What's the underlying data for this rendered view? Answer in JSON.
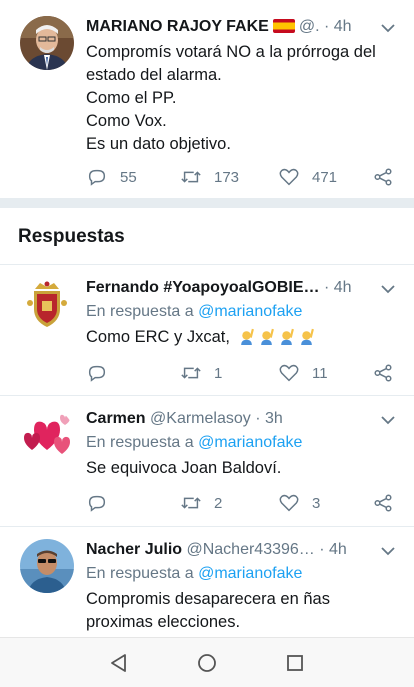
{
  "main_tweet": {
    "author_name": "MARIANO RAJOY FAKE",
    "handle": "@.",
    "time": "4h",
    "lines": [
      "Compromís votará NO a la prórroga del",
      "estado del alarma.",
      "Como el PP.",
      "Como Vox.",
      "Es un dato objetivo."
    ],
    "replies": "55",
    "retweets": "173",
    "likes": "471"
  },
  "section": {
    "title": "Respuestas"
  },
  "replies": [
    {
      "author_name": "Fernando #YoapoyoalGOBIE…",
      "handle": "",
      "time": "4h",
      "reply_prefix": "En respuesta a",
      "mention": "@marianofake",
      "lines": [
        "Como ERC y Jxcat,"
      ],
      "emoji_count": 4,
      "replies": "",
      "retweets": "1",
      "likes": "11"
    },
    {
      "author_name": "Carmen",
      "handle": "@Karmelasoy",
      "time": "3h",
      "reply_prefix": "En respuesta a",
      "mention": "@marianofake",
      "lines": [
        "Se equivoca Joan Baldoví."
      ],
      "replies": "",
      "retweets": "2",
      "likes": "3"
    },
    {
      "author_name": "Nacher Julio",
      "handle": "@Nacher43396…",
      "time": "4h",
      "reply_prefix": "En respuesta a",
      "mention": "@marianofake",
      "lines": [
        "Compromis desaparecera en ñas",
        "proximas elecciones."
      ]
    }
  ],
  "icons": {
    "reply": "reply-icon",
    "retweet": "retweet-icon",
    "like": "heart-icon",
    "share": "share-icon",
    "menu": "chevron-down-icon",
    "nav_back": "back-triangle-icon",
    "nav_home": "home-circle-icon",
    "nav_recents": "recents-square-icon"
  },
  "colors": {
    "accent": "#1da1f2",
    "muted": "#657786",
    "text": "#14171a",
    "divider": "#e6ecf0"
  }
}
